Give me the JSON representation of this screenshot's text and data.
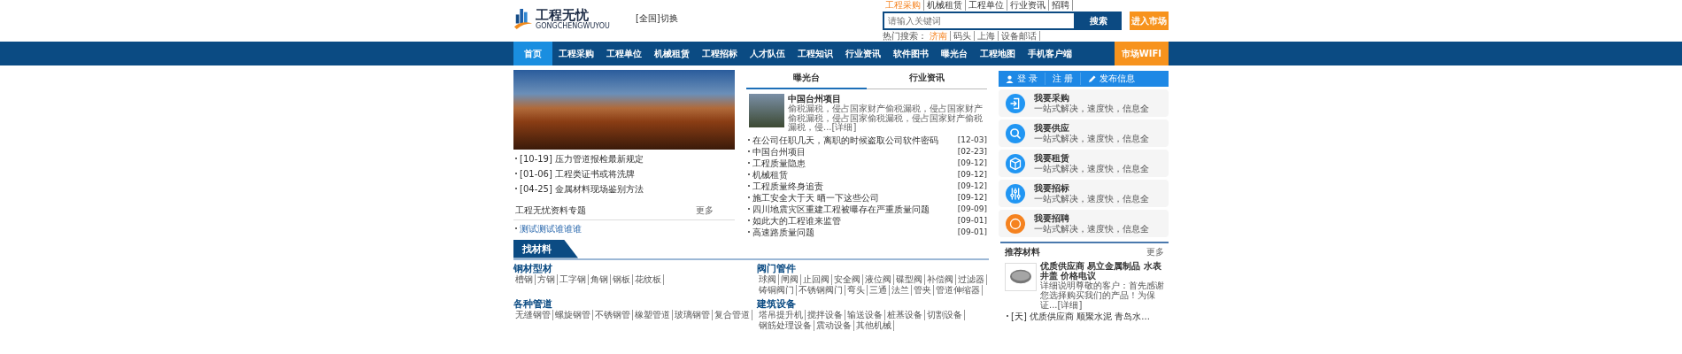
{
  "top_links": [
    {
      "label": "工程采购",
      "highlighted": true
    },
    {
      "label": "机械租赁",
      "highlighted": false
    },
    {
      "label": "工程单位",
      "highlighted": false
    },
    {
      "label": "行业资讯",
      "highlighted": false
    },
    {
      "label": "招聘",
      "highlighted": false
    }
  ],
  "logo": {
    "name": "工程无忧",
    "subtitle": "GONGCHENGWUYOU"
  },
  "region_switch": "[全国]切换",
  "search": {
    "placeholder": "请输入关键词",
    "button": "搜索"
  },
  "market_button": "进入市场",
  "hot_search": {
    "label": "热门搜索：",
    "terms": [
      {
        "text": "济南",
        "highlighted": true
      },
      {
        "text": "码头",
        "highlighted": false
      },
      {
        "text": "上海",
        "highlighted": false
      },
      {
        "text": "设备邮话",
        "highlighted": false
      }
    ]
  },
  "nav": [
    {
      "label": "首页",
      "selected": true
    },
    {
      "label": "工程采购",
      "selected": false
    },
    {
      "label": "工程单位",
      "selected": false
    },
    {
      "label": "机械租赁",
      "selected": false
    },
    {
      "label": "工程招标",
      "selected": false
    },
    {
      "label": "人才队伍",
      "selected": false
    },
    {
      "label": "工程知识",
      "selected": false
    },
    {
      "label": "行业资讯",
      "selected": false
    },
    {
      "label": "软件图书",
      "selected": false
    },
    {
      "label": "曝光台",
      "selected": false
    },
    {
      "label": "工程地图",
      "selected": false
    },
    {
      "label": "手机客户端",
      "selected": false
    }
  ],
  "nav_wifi": "市场WIFI",
  "left_news": [
    {
      "date": "[10-19]",
      "title": "压力管道报检最新规定"
    },
    {
      "date": "[01-06]",
      "title": "工程类证书或将洗牌"
    },
    {
      "date": "[04-25]",
      "title": "金属材料现场鉴别方法"
    }
  ],
  "topic": {
    "title": "工程无忧资料专题",
    "more": "更多",
    "links": [
      "测试测试谁谁谁"
    ]
  },
  "tabs": [
    {
      "label": "曝光台",
      "selected": true
    },
    {
      "label": "行业资讯",
      "selected": false
    }
  ],
  "feature": {
    "title": "中国台州项目",
    "summary": "偷税漏税，侵占国家财产偷税漏税，侵占国家财产偷税漏税，侵占国家偷税漏税，侵占国家财产偷税漏税，侵...",
    "detail": "[详细]"
  },
  "news": [
    {
      "title": "在公司任职几天，离职的时候盗取公司软件密码",
      "date": "[12-03]"
    },
    {
      "title": "中国台州项目",
      "date": "[02-23]"
    },
    {
      "title": "工程质量隐患",
      "date": "[09-12]"
    },
    {
      "title": "机械租赁",
      "date": "[09-12]"
    },
    {
      "title": "工程质量终身追责",
      "date": "[09-12]"
    },
    {
      "title": "施工安全大于天 晒一下这些公司",
      "date": "[09-12]"
    },
    {
      "title": "四川地震灾区重建工程被曝存在严重质量问题",
      "date": "[09-09]"
    },
    {
      "title": "如此大的工程谁来监管",
      "date": "[09-01]"
    },
    {
      "title": "高速路质量问题",
      "date": "[09-01]"
    }
  ],
  "user_bar": {
    "login": "登 录",
    "register": "注 册",
    "publish": "发布信息"
  },
  "services": [
    {
      "kind": "purchase",
      "title": "我要采购",
      "subtitle": "一站式解决，速度快，信息全",
      "color": "#2196f3"
    },
    {
      "kind": "supply",
      "title": "我要供应",
      "subtitle": "一站式解决，速度快，信息全",
      "color": "#2196f3"
    },
    {
      "kind": "rent",
      "title": "我要租赁",
      "subtitle": "一站式解决，速度快，信息全",
      "color": "#2196f3"
    },
    {
      "kind": "tender",
      "title": "我要招标",
      "subtitle": "一站式解决，速度快，信息全",
      "color": "#2196f3"
    },
    {
      "kind": "recruit",
      "title": "我要招聘",
      "subtitle": "一站式解决，速度快，信息全",
      "color": "#f5821f"
    }
  ],
  "materials": {
    "title": "找材料",
    "categories": [
      {
        "title": "钢材型材",
        "items": [
          "槽钢",
          "方钢",
          "工字钢",
          "角钢",
          "钢板",
          "花纹板"
        ]
      },
      {
        "title": "阀门管件",
        "items": [
          "球阀",
          "闸阀",
          "止回阀",
          "安全阀",
          "液位阀",
          "碟型阀",
          "补偿阀",
          "过滤器",
          "铸铜阀门",
          "不锈钢阀门",
          "弯头",
          "三通",
          "法兰",
          "管夹",
          "管道伸缩器"
        ]
      },
      {
        "title": "各种管道",
        "items": [
          "无缝钢管",
          "螺旋钢管",
          "不锈钢管",
          "橡塑管道",
          "玻璃钢管",
          "复合管道"
        ]
      },
      {
        "title": "建筑设备",
        "items": [
          "塔吊提升机",
          "搅拌设备",
          "输送设备",
          "桩基设备",
          "切割设备",
          "钢筋处理设备",
          "震动设备",
          "其他机械"
        ]
      }
    ]
  },
  "recommend": {
    "title": "推荐材料",
    "more": "更多",
    "product": {
      "title": "优质供应商 易立金属制品 水表井盖 价格电议",
      "description": "详细说明尊敬的客户：首先感谢您选择购买我们的产品！为保证...",
      "detail": "[详细]"
    },
    "links": [
      {
        "tag": "[天]",
        "text": "优质供应商 顺聚水泥 青岛水..."
      }
    ]
  }
}
